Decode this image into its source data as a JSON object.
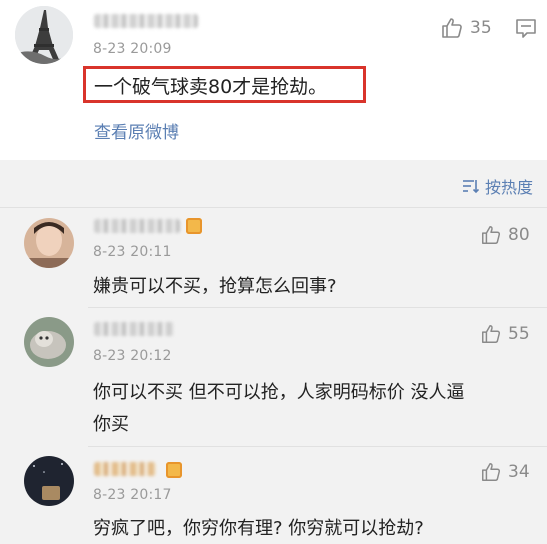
{
  "main_comment": {
    "timestamp": "8-23 20:09",
    "text": "一个破气球卖80才是抢劫。",
    "likes": "35",
    "view_original": "查看原微博"
  },
  "sort": {
    "label": "按热度"
  },
  "replies": [
    {
      "timestamp": "8-23 20:11",
      "text_lines": [
        "嫌贵可以不买，抢算怎么回事?"
      ],
      "likes": "80"
    },
    {
      "timestamp": "8-23 20:12",
      "text_lines": [
        "你可以不买 但不可以抢，人家明码标价 没人逼",
        "你买"
      ],
      "likes": "55"
    },
    {
      "timestamp": "8-23 20:17",
      "text_lines": [
        "穷疯了吧，你穷你有理? 你穷就可以抢劫?"
      ],
      "likes": "34"
    }
  ],
  "icons": {
    "like": "thumbs-up-icon",
    "comment": "comment-icon",
    "sort": "sort-icon"
  },
  "colors": {
    "highlight": "#d9342b",
    "link": "#5b7fb3"
  }
}
